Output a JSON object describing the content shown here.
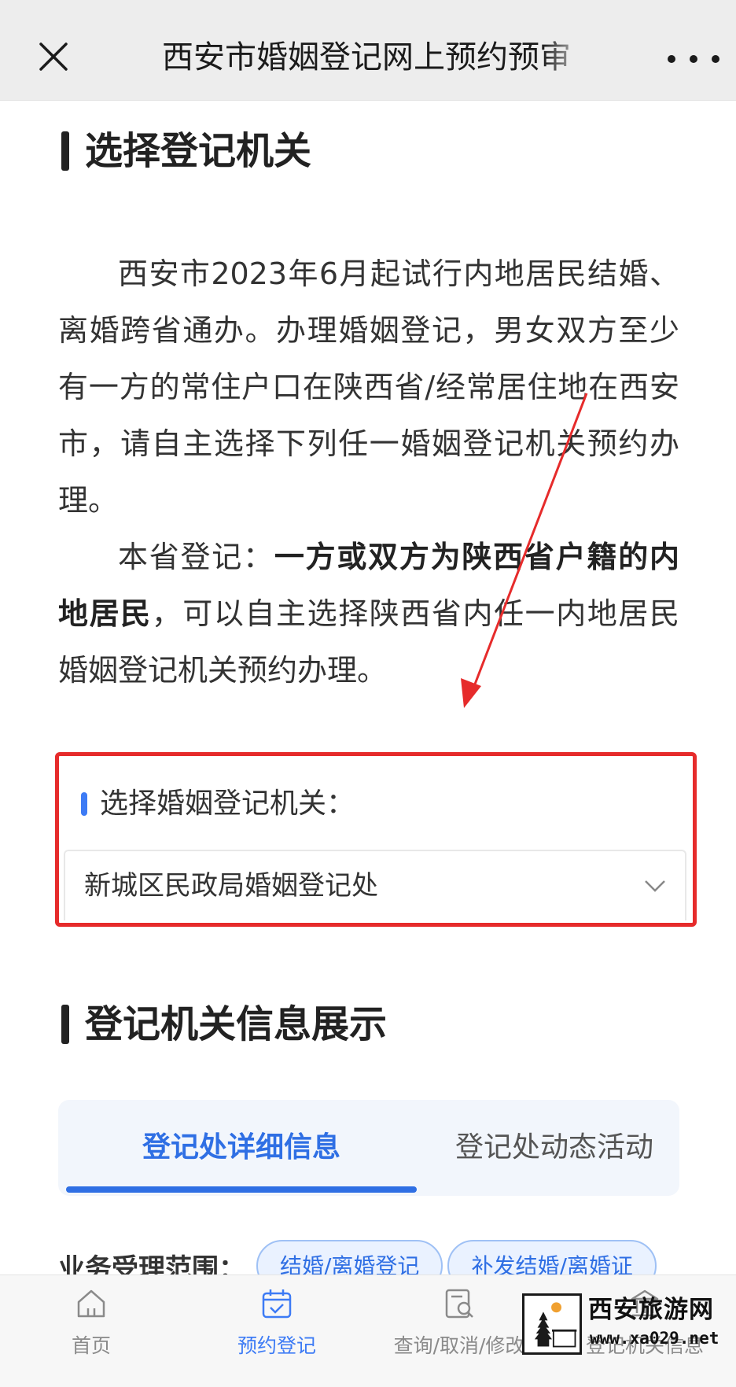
{
  "header": {
    "title": "西安市婚姻登记网上预约预审",
    "close_icon": "close-icon",
    "more_icon": "more-dots-icon"
  },
  "section1": {
    "title": "选择登记机关"
  },
  "intro": {
    "paragraph1": "西安市2023年6月起试行内地居民结婚、离婚跨省通办。办理婚姻登记，男女双方至少有一方的常住户口在陕西省/经常居住地在西安市，请自主选择下列任一婚姻登记机关预约办理。",
    "paragraph2_prefix": "本省登记：",
    "paragraph2_bold": "一方或双方为陕西省户籍的内地居民",
    "paragraph2_suffix": "，可以自主选择陕西省内任一内地居民婚姻登记机关预约办理。"
  },
  "selector": {
    "label": "选择婚姻登记机关：",
    "value": "新城区民政局婚姻登记处",
    "highlight_color": "#e62b2b",
    "accent_color": "#3d7bf5"
  },
  "section2": {
    "title": "登记机关信息展示"
  },
  "tabs": {
    "active": "登记处详细信息",
    "inactive": "登记处动态活动",
    "active_color": "#2f6fe4"
  },
  "scope": {
    "label": "业务受理范围：",
    "chips": [
      "结婚/离婚登记",
      "补发结婚/离婚证"
    ]
  },
  "bottom_nav": {
    "items": [
      {
        "label": "首页",
        "icon": "home-icon"
      },
      {
        "label": "预约登记",
        "icon": "calendar-check-icon"
      },
      {
        "label": "查询/取消/修改",
        "icon": "search-document-icon"
      },
      {
        "label": "登记机关信息",
        "icon": "institution-icon"
      }
    ]
  },
  "watermark": {
    "title": "西安旅游网",
    "url": "www.xa029.net"
  }
}
